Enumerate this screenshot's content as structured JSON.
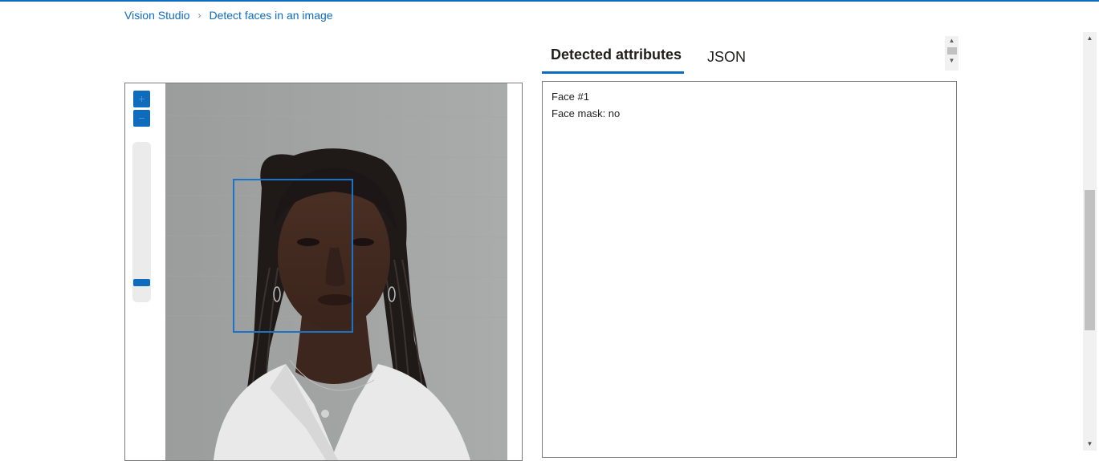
{
  "breadcrumb": {
    "items": [
      "Vision Studio",
      "Detect faces in an image"
    ],
    "separator": "›"
  },
  "tabs": [
    {
      "label": "Detected attributes",
      "active": true
    },
    {
      "label": "JSON",
      "active": false
    }
  ],
  "viewer": {
    "zoom_in_icon": "plus-icon",
    "zoom_out_icon": "minus-icon",
    "zoom_level": 0.08
  },
  "results": {
    "face_title": "Face #1",
    "face_mask": "Face mask: no"
  },
  "colors": {
    "accent": "#0f6cbd",
    "face_box": "#1a73c7"
  }
}
